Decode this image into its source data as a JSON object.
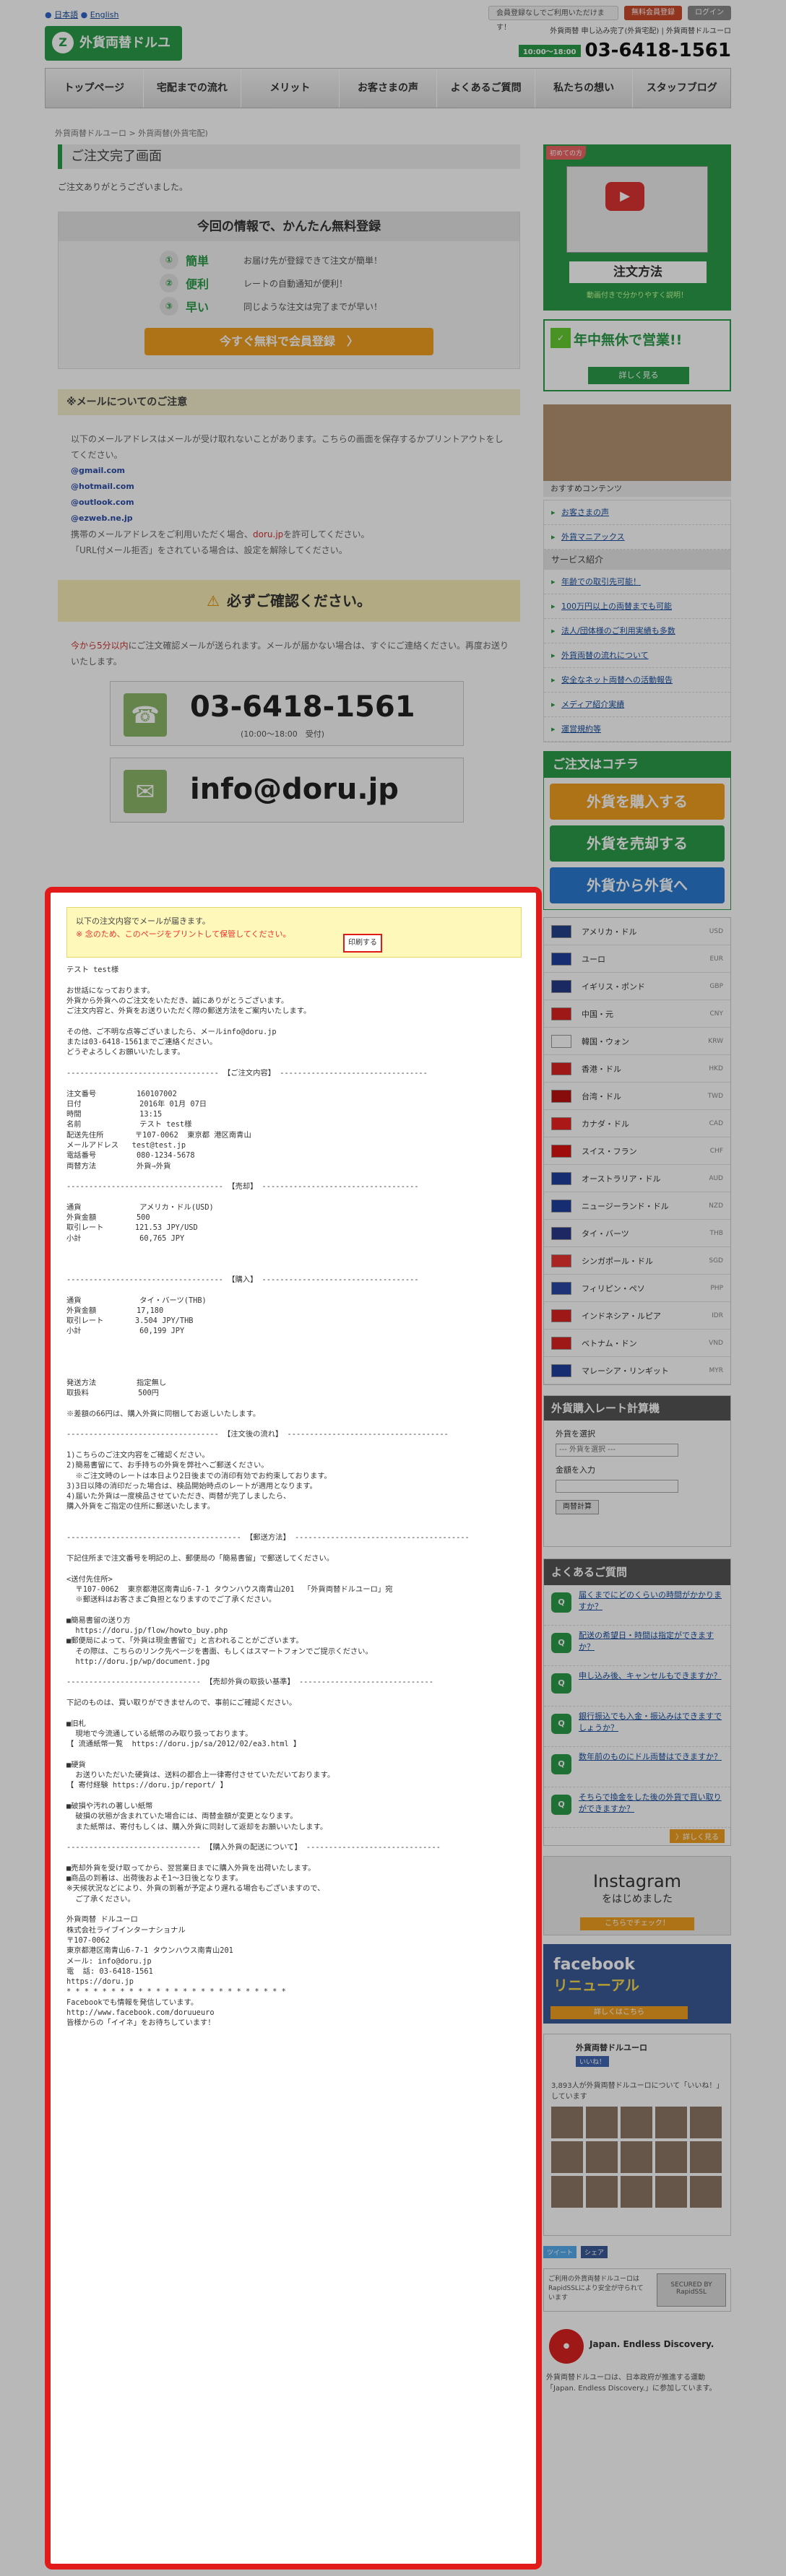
{
  "topbar": {
    "lang_ja": "日本語",
    "lang_en": "English",
    "member_text": "会員登録なしでご利用いただけます！",
    "member_btn": "無料会員登録",
    "login": "ログイン"
  },
  "header": {
    "small_text": "外貨両替 申し込み完了(外貨宅配) | 外貨両替ドルユーロ",
    "logo": "外貨両替ドルユーロ",
    "hours": "10:00～18:00",
    "tel": "03-6418-1561"
  },
  "nav": [
    "トップページ",
    "宅配までの流れ",
    "メリット",
    "お客さまの声",
    "よくあるご質問",
    "私たちの想い",
    "スタッフブログ"
  ],
  "breadcrumb": "外貨両替ドルユーロ > 外貨両替(外貨宅配)",
  "main": {
    "title": "ご注文完了画面",
    "thanks": "ご注文ありがとうございました。",
    "promo": {
      "heading": "今回の情報で、かんたん無料登録",
      "rows": [
        {
          "n": "①",
          "kw": "簡単",
          "t": "お届け先が登録できて注文が簡単！"
        },
        {
          "n": "②",
          "kw": "便利",
          "t": "レートの自動通知が便利！"
        },
        {
          "n": "③",
          "kw": "早い",
          "t": "同じような注文は完了までが早い！"
        }
      ],
      "btn": "今すぐ無料で会員登録　〉"
    },
    "mailnote": "※メールについてのご注意",
    "mailtxt1": "以下のメールアドレスはメールが受け取れないことがあります。こちらの画面を保存するかプリントアウトをしてください。",
    "domains": [
      "@gmail.com",
      "@hotmail.com",
      "@outlook.com",
      "@ezweb.ne.jp"
    ],
    "mailtxt2a": "携帯のメールアドレスをご利用いただく場合、",
    "mailtxt2b": "doru.jp",
    "mailtxt2c": "を許可してください。",
    "mailtxt3": "「URL付メール拒否」をされている場合は、設定を解除してください。",
    "confirm": "必ずご確認ください。",
    "confirm_red": "今から5分以内",
    "confirm_txt": "にご注文確認メールが送られます。メールが届かない場合は、すぐにご連絡ください。再度お送りいたします。",
    "tel": "03-6418-1561",
    "tel_hours": "(10:00～18:00　受付)",
    "email": "info@doru.jp"
  },
  "mail": {
    "notice1": "以下の注文内容でメールが届きます。",
    "notice2": "※ 念のため、このページをプリントして保管してください。",
    "print": "印刷する",
    "body": "テスト test様\n\nお世話になっております。\n外貨から外貨へのご注文をいただき、誠にありがとうございます。\nご注文内容と、外貨をお送りいただく際の郵送方法をご案内いたします。\n\nその他、ご不明な点等ございましたら、メールinfo@doru.jp\nまたは03-6418-1561までご連絡ください。\nどうぞよろしくお願いいたします。\n\n---------------------------------- 【ご注文内容】 ---------------------------------\n\n注文番号         160107002\n日付             2016年 01月 07日\n時間             13:15\n名前             テスト test様\n配送先住所       〒107-0062  東京都 港区南青山\nメールアドレス   test@test.jp\n電話番号         080-1234-5678\n両替方法         外貨⇒外貨\n\n----------------------------------- 【売却】 -----------------------------------\n\n通貨             アメリカ・ドル(USD)\n外貨金額         500\n取引レート       121.53 JPY/USD\n小計             60,765 JPY\n\n\n\n----------------------------------- 【購入】 -----------------------------------\n\n通貨             タイ・バーツ(THB)\n外貨金額         17,180\n取引レート       3.504 JPY/THB\n小計             60,199 JPY\n\n\n\n\n発送方法         指定無し\n取扱料           500円\n\n※差額の66円は、購入外貨に同梱してお返しいたします。\n\n---------------------------------- 【注文後の流れ】 ------------------------------------\n\n1)こちらのご注文内容をご確認ください。\n2)簡易書留にて、お手持ちの外貨を弊社へご郵送ください。\n  ※ご注文時のレートは本日より2日後までの消印有効でお約束しております。\n3)3日以降の消印だった場合は、検品開始時点のレートが適用となります。\n4)届いた外貨は一度検品させていただき、両替が完了しましたら、\n購入外貨をご指定の住所に郵送いたします。\n\n\n--------------------------------------- 【郵送方法】 ---------------------------------------\n\n下記住所まで注文番号を明記の上、郵便局の「簡易書留」で郵送してください。\n\n<送付先住所>\n  〒107-0062  東京都港区南青山6-7-1 タウンハウス南青山201  「外貨両替ドルユーロ」宛\n  ※郵送料はお客さまご負担となりますのでご了承ください。\n\n■簡易書留の送り方\n  https://doru.jp/flow/howto_buy.php\n■郵便局によって、「外貨は現金書留で」と言われることがございます。\n  その際は、こちらのリンク先ページを書面、もしくはスマートフォンでご提示ください。\n  http://doru.jp/wp/document.jpg\n\n------------------------------ 【売却外貨の取扱い基準】 ------------------------------\n\n下記のものは、買い取りができませんので、事前にご確認ください。\n\n■旧札\n  現地で今流通している紙幣のみ取り扱っております。\n【 流通紙幣一覧  https://doru.jp/sa/2012/02/ea3.html 】\n\n■硬貨\n  お送りいただいた硬貨は、送料の都合上一律寄付させていただいております。\n【 寄付経験 https://doru.jp/report/ 】\n\n■破損や汚れの著しい紙幣\n  破損の状態が含まれていた場合には、両替金額が変更となります。\n  また紙幣は、寄付もしくは、購入外貨に同封して返却をお願いいたします。\n\n------------------------------ 【購入外貨の配送について】 ------------------------------\n\n■売却外貨を受け取ってから、翌営業日までに購入外貨を出荷いたします。\n■商品の到着は、出荷後およそ1～3日後となります。\n※天候状況などにより、外貨の到着が予定より遅れる場合もございますので、\n  ご了承ください。\n\n外貨両替 ドルユーロ\n株式会社ライブインターナショナル\n〒107-0062\n東京都港区南青山6-7-1 タウンハウス南青山201\nメール: info@doru.jp\n電  話: 03-6418-1561\nhttps://doru.jp\n* * * * * * * * * * * * * * * * * * * * * * * * *\nFacebookでも情報を発信しています。\nhttp://www.facebook.com/doruueuro\n皆様からの「イイネ」をお待ちしています！"
  },
  "side": {
    "video_badge": "初めての方",
    "video_label": "注文方法",
    "video_cap": "動画付きで分かりやすく説明！",
    "open_title": "年中無休で営業!!",
    "open_btn": "詳しく見る",
    "staff_cap": "おすすめコンテンツ",
    "links1": [
      "お客さまの声",
      "外貨マニアックス"
    ],
    "links_hd": "サービス紹介",
    "links2": [
      "年齢での取引先可能！",
      "100万円以上の両替までも可能",
      "法人/団体様のご利用実績も多数",
      "外貨両替の流れについて",
      "安全なネット両替への活動報告",
      "メディア紹介実績",
      "運営規約等"
    ],
    "order_hd": "ご注文はコチラ",
    "order_btns": [
      {
        "t": "外貨を購入する",
        "c": "#f1a020"
      },
      {
        "t": "外貨を売却する",
        "c": "#2b9b48"
      },
      {
        "t": "外貨から外貨へ",
        "c": "#2a7bd0"
      }
    ],
    "currencies": [
      {
        "n": "アメリカ・ドル",
        "c": "USD",
        "f": "#23418a"
      },
      {
        "n": "ユーロ",
        "c": "EUR",
        "f": "#1f3f9e"
      },
      {
        "n": "イギリス・ポンド",
        "c": "GBP",
        "f": "#253a88"
      },
      {
        "n": "中国・元",
        "c": "CNY",
        "f": "#d22"
      },
      {
        "n": "韓国・ウォン",
        "c": "KRW",
        "f": "#fff"
      },
      {
        "n": "香港・ドル",
        "c": "HKD",
        "f": "#d22"
      },
      {
        "n": "台湾・ドル",
        "c": "TWD",
        "f": "#b11"
      },
      {
        "n": "カナダ・ドル",
        "c": "CAD",
        "f": "#e22"
      },
      {
        "n": "スイス・フラン",
        "c": "CHF",
        "f": "#d11"
      },
      {
        "n": "オーストラリア・ドル",
        "c": "AUD",
        "f": "#1f3f9e"
      },
      {
        "n": "ニュージーランド・ドル",
        "c": "NZD",
        "f": "#1f3f9e"
      },
      {
        "n": "タイ・バーツ",
        "c": "THB",
        "f": "#2a3a8a"
      },
      {
        "n": "シンガポール・ドル",
        "c": "SGD",
        "f": "#e33"
      },
      {
        "n": "フィリピン・ペソ",
        "c": "PHP",
        "f": "#2a46a6"
      },
      {
        "n": "インドネシア・ルピア",
        "c": "IDR",
        "f": "#d22"
      },
      {
        "n": "ベトナム・ドン",
        "c": "VND",
        "f": "#d22"
      },
      {
        "n": "マレーシア・リンギット",
        "c": "MYR",
        "f": "#1f3f9e"
      }
    ],
    "calc_hd": "外貨購入レート計算機",
    "calc_l1": "外貨を選択",
    "calc_sel": "--- 外貨を選択 ---",
    "calc_l2": "金額を入力",
    "calc_btn": "両替計算",
    "faq_hd": "よくあるご質問",
    "faqs": [
      "届くまでにどのくらいの時間がかかりますか？",
      "配送の希望日・時間は指定ができますか？",
      "申し込み後、キャンセルもできますか？",
      "銀行振込でも入金・振込みはできますでしょうか？",
      "数年前のものにドル両替はできますか？",
      "そちらで換金をした後の外貨で買い取りができますか？"
    ],
    "faq_more": "〉詳しく見る",
    "insta_t": "Instagram",
    "insta_s": "をはじめました",
    "insta_b": "こちらでチェック！",
    "fb_t": "facebook",
    "fb_s": "リニューアル",
    "fb_b": "詳しくはこちら",
    "fbw_name": "外貨両替ドルユーロ",
    "fbw_like": "いいね！",
    "fbw_desc": "3,893人が外貨両替ドルユーロについて「いいね！」しています",
    "tw": "ツイート",
    "fbs": "シェア",
    "ssl_t": "ご利用の外貨両替ドルユーロはRapidSSLにより安全が守られています",
    "ssl_seal": "SECURED BY RapidSSL",
    "jed_t": "Japan. Endless Discovery.",
    "jed_txt": "外貨両替ドルユーロは、日本政府が推進する運動「Japan. Endless Discovery.」に参加しています。"
  }
}
